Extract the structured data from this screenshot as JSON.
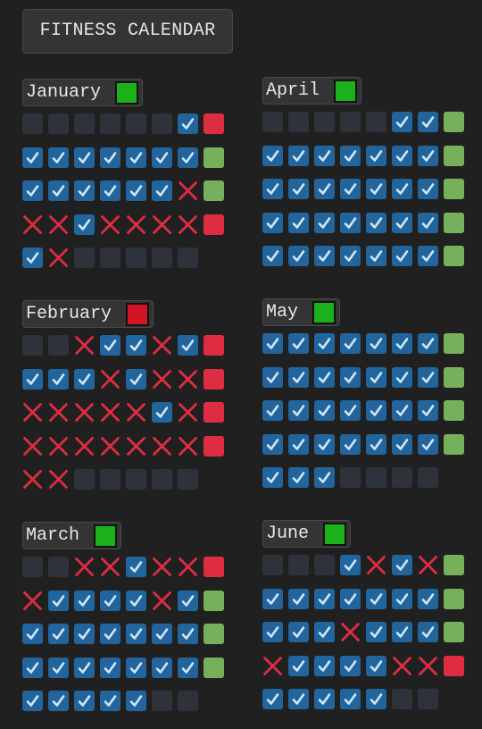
{
  "app": {
    "title": "FITNESS CALENDAR"
  },
  "colors": {
    "background": "#202020",
    "empty": "#2e333b",
    "check_bg": "#22659c",
    "check_mark": "#cfe7f8",
    "cross": "#de2d42",
    "week_good": "#77b05a",
    "week_bad": "#de2d42",
    "month_good": "#1bb11b",
    "month_bad": "#d21525"
  },
  "legend": {
    "empty": "no-day",
    "check": "workout-done",
    "cross": "workout-missed",
    "good": "week-success",
    "bad": "week-fail"
  },
  "months": [
    {
      "name": "January",
      "status": "good",
      "weeks": [
        {
          "days": [
            "empty",
            "empty",
            "empty",
            "empty",
            "empty",
            "empty",
            "check"
          ],
          "summary": "bad"
        },
        {
          "days": [
            "check",
            "check",
            "check",
            "check",
            "check",
            "check",
            "check"
          ],
          "summary": "good"
        },
        {
          "days": [
            "check",
            "check",
            "check",
            "check",
            "check",
            "check",
            "cross"
          ],
          "summary": "good"
        },
        {
          "days": [
            "cross",
            "cross",
            "check",
            "cross",
            "cross",
            "cross",
            "cross"
          ],
          "summary": "bad"
        },
        {
          "days": [
            "check",
            "cross",
            "empty",
            "empty",
            "empty",
            "empty",
            "empty"
          ],
          "summary": "none"
        }
      ]
    },
    {
      "name": "February",
      "status": "bad",
      "weeks": [
        {
          "days": [
            "empty",
            "empty",
            "cross",
            "check",
            "check",
            "cross",
            "check"
          ],
          "summary": "bad"
        },
        {
          "days": [
            "check",
            "check",
            "check",
            "cross",
            "check",
            "cross",
            "cross"
          ],
          "summary": "bad"
        },
        {
          "days": [
            "cross",
            "cross",
            "cross",
            "cross",
            "cross",
            "check",
            "cross"
          ],
          "summary": "bad"
        },
        {
          "days": [
            "cross",
            "cross",
            "cross",
            "cross",
            "cross",
            "cross",
            "cross"
          ],
          "summary": "bad"
        },
        {
          "days": [
            "cross",
            "cross",
            "empty",
            "empty",
            "empty",
            "empty",
            "empty"
          ],
          "summary": "none"
        }
      ]
    },
    {
      "name": "March",
      "status": "good",
      "weeks": [
        {
          "days": [
            "empty",
            "empty",
            "cross",
            "cross",
            "check",
            "cross",
            "cross"
          ],
          "summary": "bad"
        },
        {
          "days": [
            "cross",
            "check",
            "check",
            "check",
            "check",
            "cross",
            "check"
          ],
          "summary": "good"
        },
        {
          "days": [
            "check",
            "check",
            "check",
            "check",
            "check",
            "check",
            "check"
          ],
          "summary": "good"
        },
        {
          "days": [
            "check",
            "check",
            "check",
            "check",
            "check",
            "check",
            "check"
          ],
          "summary": "good"
        },
        {
          "days": [
            "check",
            "check",
            "check",
            "check",
            "check",
            "empty",
            "empty"
          ],
          "summary": "none"
        }
      ]
    },
    {
      "name": "April",
      "status": "good",
      "weeks": [
        {
          "days": [
            "empty",
            "empty",
            "empty",
            "empty",
            "empty",
            "check",
            "check"
          ],
          "summary": "good"
        },
        {
          "days": [
            "check",
            "check",
            "check",
            "check",
            "check",
            "check",
            "check"
          ],
          "summary": "good"
        },
        {
          "days": [
            "check",
            "check",
            "check",
            "check",
            "check",
            "check",
            "check"
          ],
          "summary": "good"
        },
        {
          "days": [
            "check",
            "check",
            "check",
            "check",
            "check",
            "check",
            "check"
          ],
          "summary": "good"
        },
        {
          "days": [
            "check",
            "check",
            "check",
            "check",
            "check",
            "check",
            "check"
          ],
          "summary": "good"
        }
      ]
    },
    {
      "name": "May",
      "status": "good",
      "weeks": [
        {
          "days": [
            "check",
            "check",
            "check",
            "check",
            "check",
            "check",
            "check"
          ],
          "summary": "good"
        },
        {
          "days": [
            "check",
            "check",
            "check",
            "check",
            "check",
            "check",
            "check"
          ],
          "summary": "good"
        },
        {
          "days": [
            "check",
            "check",
            "check",
            "check",
            "check",
            "check",
            "check"
          ],
          "summary": "good"
        },
        {
          "days": [
            "check",
            "check",
            "check",
            "check",
            "check",
            "check",
            "check"
          ],
          "summary": "good"
        },
        {
          "days": [
            "check",
            "check",
            "check",
            "empty",
            "empty",
            "empty",
            "empty"
          ],
          "summary": "none"
        }
      ]
    },
    {
      "name": "June",
      "status": "good",
      "weeks": [
        {
          "days": [
            "empty",
            "empty",
            "empty",
            "check",
            "cross",
            "check",
            "cross"
          ],
          "summary": "good"
        },
        {
          "days": [
            "check",
            "check",
            "check",
            "check",
            "check",
            "check",
            "check"
          ],
          "summary": "good"
        },
        {
          "days": [
            "check",
            "check",
            "check",
            "cross",
            "check",
            "check",
            "check"
          ],
          "summary": "good"
        },
        {
          "days": [
            "cross",
            "check",
            "check",
            "check",
            "check",
            "cross",
            "cross"
          ],
          "summary": "bad"
        },
        {
          "days": [
            "check",
            "check",
            "check",
            "check",
            "check",
            "empty",
            "empty"
          ],
          "summary": "none"
        }
      ]
    }
  ]
}
